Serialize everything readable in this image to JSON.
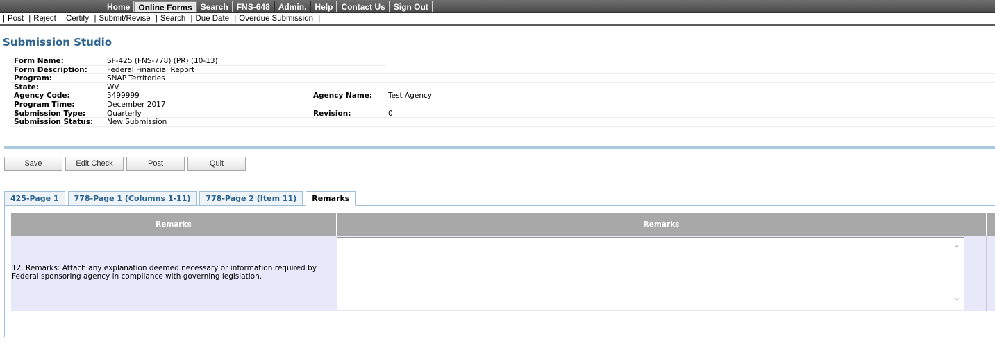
{
  "topnav": {
    "items": [
      {
        "label": "Home",
        "active": false
      },
      {
        "label": "Online Forms",
        "active": true
      },
      {
        "label": "Search",
        "active": false
      },
      {
        "label": "FNS-648",
        "active": false
      },
      {
        "label": "Admin.",
        "active": false
      },
      {
        "label": "Help",
        "active": false
      },
      {
        "label": "Contact Us",
        "active": false
      },
      {
        "label": "Sign Out",
        "active": false
      }
    ]
  },
  "subnav": {
    "items": [
      "Post",
      "Reject",
      "Certify",
      "Submit/Revise",
      "Search",
      "Due Date",
      "Overdue Submission"
    ]
  },
  "page_title": "Submission Studio",
  "info": {
    "form_name_label": "Form Name:",
    "form_name": "SF-425 (FNS-778) (PR) (10-13)",
    "form_desc_label": "Form Description:",
    "form_desc": "Federal Financial Report",
    "program_label": "Program:",
    "program": "SNAP Territories",
    "state_label": "State:",
    "state": "WV",
    "agency_code_label": "Agency Code:",
    "agency_code": "5499999",
    "agency_name_label": "Agency Name:",
    "agency_name": "Test Agency",
    "program_time_label": "Program Time:",
    "program_time": "December 2017",
    "submission_type_label": "Submission Type:",
    "submission_type": "Quarterly",
    "revision_label": "Revision:",
    "revision": "0",
    "submission_status_label": "Submission Status:",
    "submission_status": "New Submission"
  },
  "buttons": {
    "save": "Save",
    "edit_check": "Edit Check",
    "post": "Post",
    "quit": "Quit"
  },
  "tabs": [
    {
      "label": "425-Page 1",
      "active": false
    },
    {
      "label": "778-Page 1 (Columns 1-11)",
      "active": false
    },
    {
      "label": "778-Page 2 (Item 11)",
      "active": false
    },
    {
      "label": "Remarks",
      "active": true
    }
  ],
  "grid": {
    "col1_header": "Remarks",
    "col2_header": "Remarks",
    "row_label": "12. Remarks: Attach any explanation deemed necessary or information required by Federal sponsoring agency in compliance with governing legislation.",
    "remarks_value": ""
  },
  "colors": {
    "title": "#2d6390",
    "header_bg": "#a8a8a8",
    "row_bg": "#e8e8fb",
    "accent_bar": "#a9c9e1"
  }
}
